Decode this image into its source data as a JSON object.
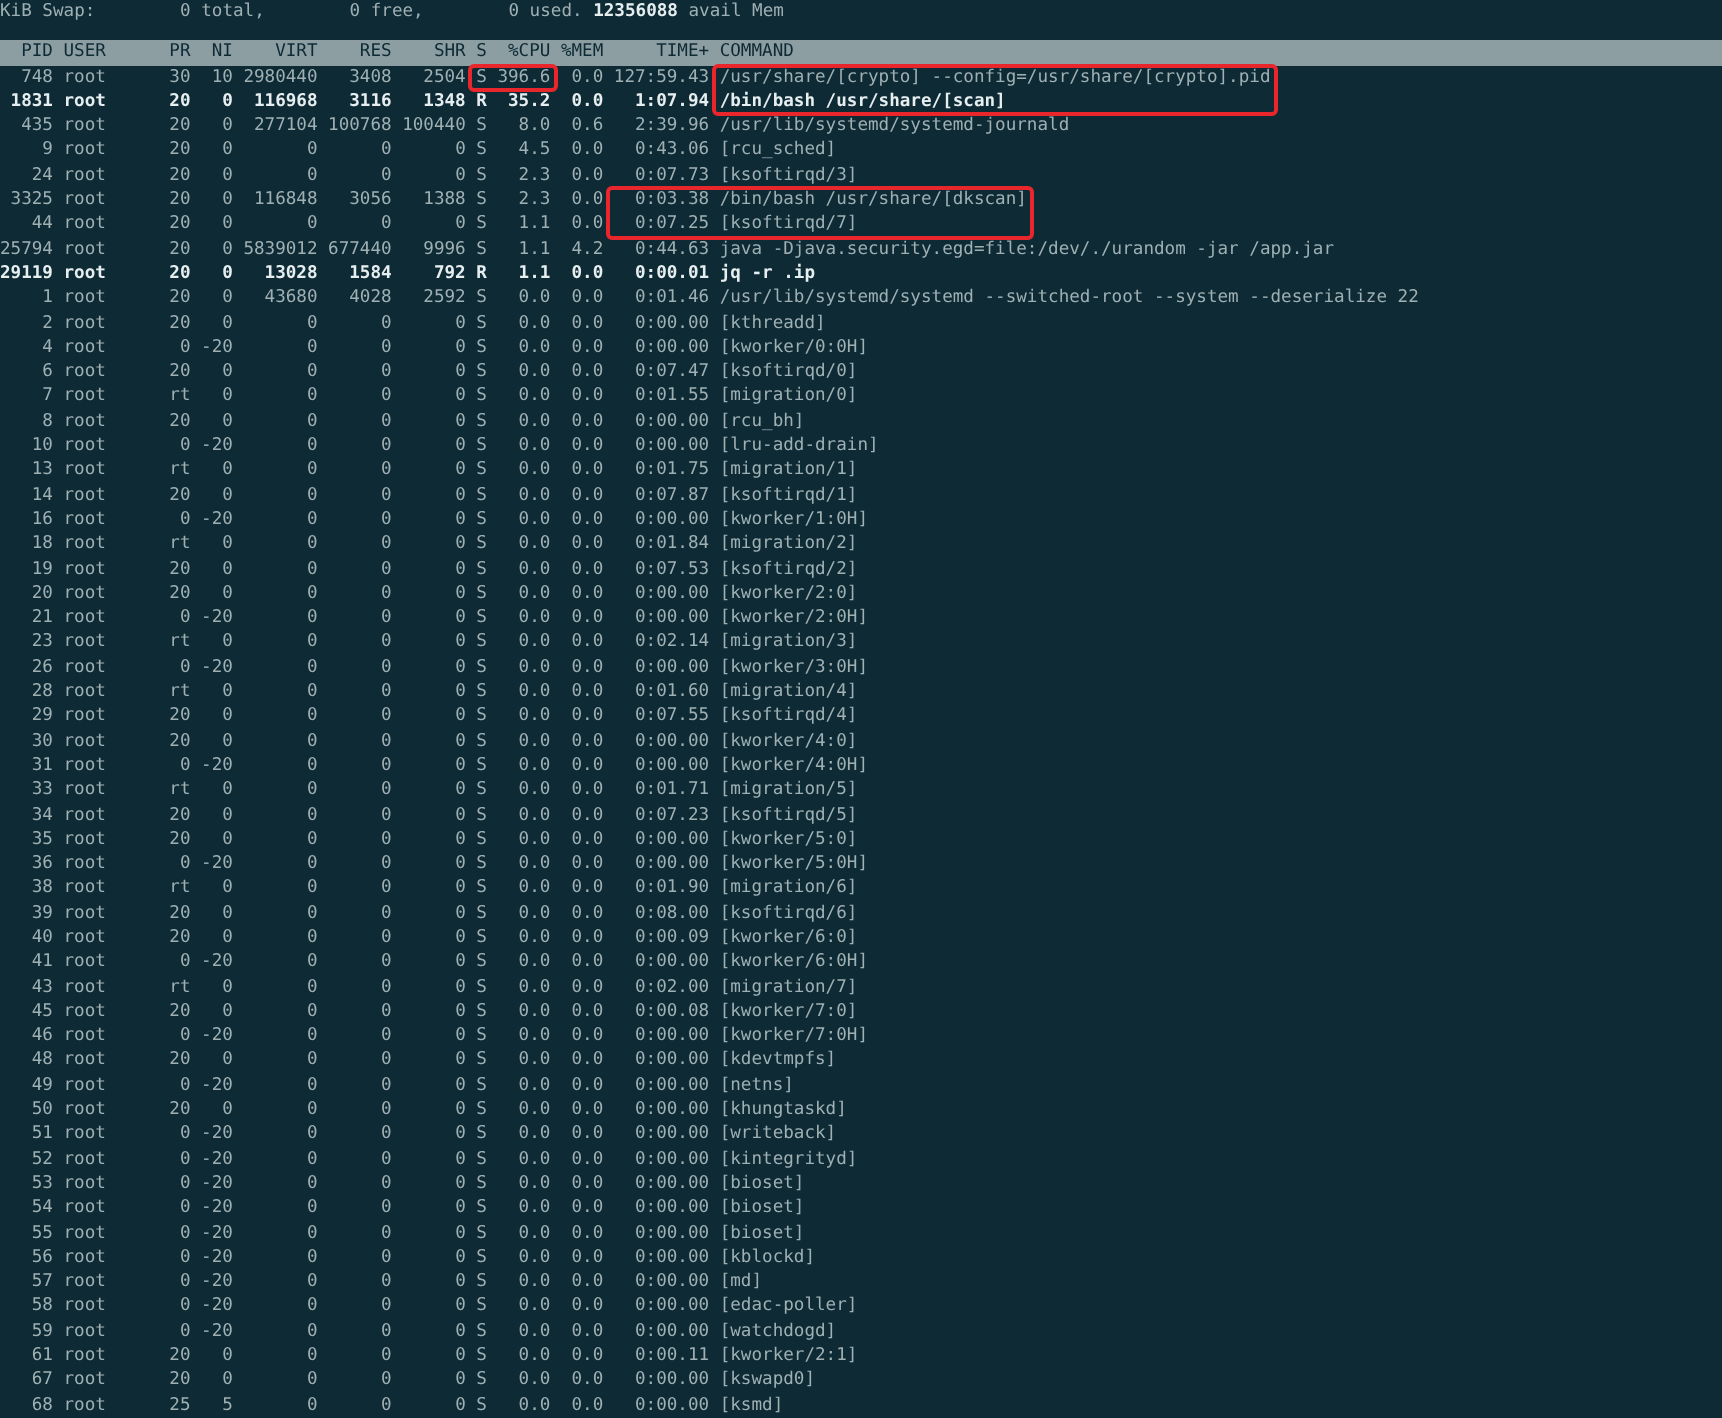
{
  "swap_line": "KiB Swap:        0 total,        0 free,        0 used. **12356088** avail Mem",
  "table": {
    "columns": [
      "PID",
      "USER",
      "PR",
      "NI",
      "VIRT",
      "RES",
      "SHR",
      "S",
      "%CPU",
      "%MEM",
      "TIME+",
      "COMMAND"
    ],
    "rows": [
      {
        "bold": false,
        "marks": [
          {
            "kind": "cpu",
            "continues": false
          },
          {
            "kind": "command",
            "continues": true
          }
        ],
        "cells": [
          "748",
          "root",
          "30",
          "10",
          "2980440",
          "3408",
          "2504",
          "S",
          "396.6",
          "0.0",
          "127:59.43",
          "/usr/share/[crypto] --config=/usr/share/[crypto].pid"
        ]
      },
      {
        "bold": true,
        "marks": [
          {
            "kind": "command",
            "continues": false
          }
        ],
        "cells": [
          "1831",
          "root",
          "20",
          "0",
          "116968",
          "3116",
          "1348",
          "R",
          "35.2",
          "0.0",
          "1:07.94",
          "/bin/bash /usr/share/[scan]"
        ]
      },
      {
        "bold": false,
        "cells": [
          "435",
          "root",
          "20",
          "0",
          "277104",
          "100768",
          "100440",
          "S",
          "8.0",
          "0.6",
          "2:39.96",
          "/usr/lib/systemd/systemd-journald"
        ]
      },
      {
        "bold": false,
        "cells": [
          "9",
          "root",
          "20",
          "0",
          "0",
          "0",
          "0",
          "S",
          "4.5",
          "0.0",
          "0:43.06",
          "[rcu_sched]"
        ]
      },
      {
        "bold": false,
        "cells": [
          "24",
          "root",
          "20",
          "0",
          "0",
          "0",
          "0",
          "S",
          "2.3",
          "0.0",
          "0:07.73",
          "[ksoftirqd/3]"
        ]
      },
      {
        "bold": false,
        "marks": [
          {
            "kind": "time_command",
            "continues": true
          }
        ],
        "cells": [
          "3325",
          "root",
          "20",
          "0",
          "116848",
          "3056",
          "1388",
          "S",
          "2.3",
          "0.0",
          "0:03.38",
          "/bin/bash /usr/share/[dkscan]"
        ]
      },
      {
        "bold": false,
        "marks": [
          {
            "kind": "time_command",
            "continues": false
          }
        ],
        "cells": [
          "44",
          "root",
          "20",
          "0",
          "0",
          "0",
          "0",
          "S",
          "1.1",
          "0.0",
          "0:07.25",
          "[ksoftirqd/7]"
        ]
      },
      {
        "bold": false,
        "cells": [
          "25794",
          "root",
          "20",
          "0",
          "5839012",
          "677440",
          "9996",
          "S",
          "1.1",
          "4.2",
          "0:44.63",
          "java -Djava.security.egd=file:/dev/./urandom -jar /app.jar"
        ]
      },
      {
        "bold": true,
        "cells": [
          "29119",
          "root",
          "20",
          "0",
          "13028",
          "1584",
          "792",
          "R",
          "1.1",
          "0.0",
          "0:00.01",
          "jq -r .ip"
        ]
      },
      {
        "bold": false,
        "cells": [
          "1",
          "root",
          "20",
          "0",
          "43680",
          "4028",
          "2592",
          "S",
          "0.0",
          "0.0",
          "0:01.46",
          "/usr/lib/systemd/systemd --switched-root --system --deserialize 22"
        ]
      },
      {
        "bold": false,
        "cells": [
          "2",
          "root",
          "20",
          "0",
          "0",
          "0",
          "0",
          "S",
          "0.0",
          "0.0",
          "0:00.00",
          "[kthreadd]"
        ]
      },
      {
        "bold": false,
        "cells": [
          "4",
          "root",
          "0",
          "-20",
          "0",
          "0",
          "0",
          "S",
          "0.0",
          "0.0",
          "0:00.00",
          "[kworker/0:0H]"
        ]
      },
      {
        "bold": false,
        "cells": [
          "6",
          "root",
          "20",
          "0",
          "0",
          "0",
          "0",
          "S",
          "0.0",
          "0.0",
          "0:07.47",
          "[ksoftirqd/0]"
        ]
      },
      {
        "bold": false,
        "cells": [
          "7",
          "root",
          "rt",
          "0",
          "0",
          "0",
          "0",
          "S",
          "0.0",
          "0.0",
          "0:01.55",
          "[migration/0]"
        ]
      },
      {
        "bold": false,
        "cells": [
          "8",
          "root",
          "20",
          "0",
          "0",
          "0",
          "0",
          "S",
          "0.0",
          "0.0",
          "0:00.00",
          "[rcu_bh]"
        ]
      },
      {
        "bold": false,
        "cells": [
          "10",
          "root",
          "0",
          "-20",
          "0",
          "0",
          "0",
          "S",
          "0.0",
          "0.0",
          "0:00.00",
          "[lru-add-drain]"
        ]
      },
      {
        "bold": false,
        "cells": [
          "13",
          "root",
          "rt",
          "0",
          "0",
          "0",
          "0",
          "S",
          "0.0",
          "0.0",
          "0:01.75",
          "[migration/1]"
        ]
      },
      {
        "bold": false,
        "cells": [
          "14",
          "root",
          "20",
          "0",
          "0",
          "0",
          "0",
          "S",
          "0.0",
          "0.0",
          "0:07.87",
          "[ksoftirqd/1]"
        ]
      },
      {
        "bold": false,
        "cells": [
          "16",
          "root",
          "0",
          "-20",
          "0",
          "0",
          "0",
          "S",
          "0.0",
          "0.0",
          "0:00.00",
          "[kworker/1:0H]"
        ]
      },
      {
        "bold": false,
        "cells": [
          "18",
          "root",
          "rt",
          "0",
          "0",
          "0",
          "0",
          "S",
          "0.0",
          "0.0",
          "0:01.84",
          "[migration/2]"
        ]
      },
      {
        "bold": false,
        "cells": [
          "19",
          "root",
          "20",
          "0",
          "0",
          "0",
          "0",
          "S",
          "0.0",
          "0.0",
          "0:07.53",
          "[ksoftirqd/2]"
        ]
      },
      {
        "bold": false,
        "cells": [
          "20",
          "root",
          "20",
          "0",
          "0",
          "0",
          "0",
          "S",
          "0.0",
          "0.0",
          "0:00.00",
          "[kworker/2:0]"
        ]
      },
      {
        "bold": false,
        "cells": [
          "21",
          "root",
          "0",
          "-20",
          "0",
          "0",
          "0",
          "S",
          "0.0",
          "0.0",
          "0:00.00",
          "[kworker/2:0H]"
        ]
      },
      {
        "bold": false,
        "cells": [
          "23",
          "root",
          "rt",
          "0",
          "0",
          "0",
          "0",
          "S",
          "0.0",
          "0.0",
          "0:02.14",
          "[migration/3]"
        ]
      },
      {
        "bold": false,
        "cells": [
          "26",
          "root",
          "0",
          "-20",
          "0",
          "0",
          "0",
          "S",
          "0.0",
          "0.0",
          "0:00.00",
          "[kworker/3:0H]"
        ]
      },
      {
        "bold": false,
        "cells": [
          "28",
          "root",
          "rt",
          "0",
          "0",
          "0",
          "0",
          "S",
          "0.0",
          "0.0",
          "0:01.60",
          "[migration/4]"
        ]
      },
      {
        "bold": false,
        "cells": [
          "29",
          "root",
          "20",
          "0",
          "0",
          "0",
          "0",
          "S",
          "0.0",
          "0.0",
          "0:07.55",
          "[ksoftirqd/4]"
        ]
      },
      {
        "bold": false,
        "cells": [
          "30",
          "root",
          "20",
          "0",
          "0",
          "0",
          "0",
          "S",
          "0.0",
          "0.0",
          "0:00.00",
          "[kworker/4:0]"
        ]
      },
      {
        "bold": false,
        "cells": [
          "31",
          "root",
          "0",
          "-20",
          "0",
          "0",
          "0",
          "S",
          "0.0",
          "0.0",
          "0:00.00",
          "[kworker/4:0H]"
        ]
      },
      {
        "bold": false,
        "cells": [
          "33",
          "root",
          "rt",
          "0",
          "0",
          "0",
          "0",
          "S",
          "0.0",
          "0.0",
          "0:01.71",
          "[migration/5]"
        ]
      },
      {
        "bold": false,
        "cells": [
          "34",
          "root",
          "20",
          "0",
          "0",
          "0",
          "0",
          "S",
          "0.0",
          "0.0",
          "0:07.23",
          "[ksoftirqd/5]"
        ]
      },
      {
        "bold": false,
        "cells": [
          "35",
          "root",
          "20",
          "0",
          "0",
          "0",
          "0",
          "S",
          "0.0",
          "0.0",
          "0:00.00",
          "[kworker/5:0]"
        ]
      },
      {
        "bold": false,
        "cells": [
          "36",
          "root",
          "0",
          "-20",
          "0",
          "0",
          "0",
          "S",
          "0.0",
          "0.0",
          "0:00.00",
          "[kworker/5:0H]"
        ]
      },
      {
        "bold": false,
        "cells": [
          "38",
          "root",
          "rt",
          "0",
          "0",
          "0",
          "0",
          "S",
          "0.0",
          "0.0",
          "0:01.90",
          "[migration/6]"
        ]
      },
      {
        "bold": false,
        "cells": [
          "39",
          "root",
          "20",
          "0",
          "0",
          "0",
          "0",
          "S",
          "0.0",
          "0.0",
          "0:08.00",
          "[ksoftirqd/6]"
        ]
      },
      {
        "bold": false,
        "cells": [
          "40",
          "root",
          "20",
          "0",
          "0",
          "0",
          "0",
          "S",
          "0.0",
          "0.0",
          "0:00.09",
          "[kworker/6:0]"
        ]
      },
      {
        "bold": false,
        "cells": [
          "41",
          "root",
          "0",
          "-20",
          "0",
          "0",
          "0",
          "S",
          "0.0",
          "0.0",
          "0:00.00",
          "[kworker/6:0H]"
        ]
      },
      {
        "bold": false,
        "cells": [
          "43",
          "root",
          "rt",
          "0",
          "0",
          "0",
          "0",
          "S",
          "0.0",
          "0.0",
          "0:02.00",
          "[migration/7]"
        ]
      },
      {
        "bold": false,
        "cells": [
          "45",
          "root",
          "20",
          "0",
          "0",
          "0",
          "0",
          "S",
          "0.0",
          "0.0",
          "0:00.08",
          "[kworker/7:0]"
        ]
      },
      {
        "bold": false,
        "cells": [
          "46",
          "root",
          "0",
          "-20",
          "0",
          "0",
          "0",
          "S",
          "0.0",
          "0.0",
          "0:00.00",
          "[kworker/7:0H]"
        ]
      },
      {
        "bold": false,
        "cells": [
          "48",
          "root",
          "20",
          "0",
          "0",
          "0",
          "0",
          "S",
          "0.0",
          "0.0",
          "0:00.00",
          "[kdevtmpfs]"
        ]
      },
      {
        "bold": false,
        "cells": [
          "49",
          "root",
          "0",
          "-20",
          "0",
          "0",
          "0",
          "S",
          "0.0",
          "0.0",
          "0:00.00",
          "[netns]"
        ]
      },
      {
        "bold": false,
        "cells": [
          "50",
          "root",
          "20",
          "0",
          "0",
          "0",
          "0",
          "S",
          "0.0",
          "0.0",
          "0:00.00",
          "[khungtaskd]"
        ]
      },
      {
        "bold": false,
        "cells": [
          "51",
          "root",
          "0",
          "-20",
          "0",
          "0",
          "0",
          "S",
          "0.0",
          "0.0",
          "0:00.00",
          "[writeback]"
        ]
      },
      {
        "bold": false,
        "cells": [
          "52",
          "root",
          "0",
          "-20",
          "0",
          "0",
          "0",
          "S",
          "0.0",
          "0.0",
          "0:00.00",
          "[kintegrityd]"
        ]
      },
      {
        "bold": false,
        "cells": [
          "53",
          "root",
          "0",
          "-20",
          "0",
          "0",
          "0",
          "S",
          "0.0",
          "0.0",
          "0:00.00",
          "[bioset]"
        ]
      },
      {
        "bold": false,
        "cells": [
          "54",
          "root",
          "0",
          "-20",
          "0",
          "0",
          "0",
          "S",
          "0.0",
          "0.0",
          "0:00.00",
          "[bioset]"
        ]
      },
      {
        "bold": false,
        "cells": [
          "55",
          "root",
          "0",
          "-20",
          "0",
          "0",
          "0",
          "S",
          "0.0",
          "0.0",
          "0:00.00",
          "[bioset]"
        ]
      },
      {
        "bold": false,
        "cells": [
          "56",
          "root",
          "0",
          "-20",
          "0",
          "0",
          "0",
          "S",
          "0.0",
          "0.0",
          "0:00.00",
          "[kblockd]"
        ]
      },
      {
        "bold": false,
        "cells": [
          "57",
          "root",
          "0",
          "-20",
          "0",
          "0",
          "0",
          "S",
          "0.0",
          "0.0",
          "0:00.00",
          "[md]"
        ]
      },
      {
        "bold": false,
        "cells": [
          "58",
          "root",
          "0",
          "-20",
          "0",
          "0",
          "0",
          "S",
          "0.0",
          "0.0",
          "0:00.00",
          "[edac-poller]"
        ]
      },
      {
        "bold": false,
        "cells": [
          "59",
          "root",
          "0",
          "-20",
          "0",
          "0",
          "0",
          "S",
          "0.0",
          "0.0",
          "0:00.00",
          "[watchdogd]"
        ]
      },
      {
        "bold": false,
        "cells": [
          "61",
          "root",
          "20",
          "0",
          "0",
          "0",
          "0",
          "S",
          "0.0",
          "0.0",
          "0:00.11",
          "[kworker/2:1]"
        ]
      },
      {
        "bold": false,
        "cells": [
          "67",
          "root",
          "20",
          "0",
          "0",
          "0",
          "0",
          "S",
          "0.0",
          "0.0",
          "0:00.00",
          "[kswapd0]"
        ]
      },
      {
        "bold": false,
        "cells": [
          "68",
          "root",
          "25",
          "5",
          "0",
          "0",
          "0",
          "S",
          "0.0",
          "0.0",
          "0:00.00",
          "[ksmd]"
        ]
      }
    ]
  }
}
